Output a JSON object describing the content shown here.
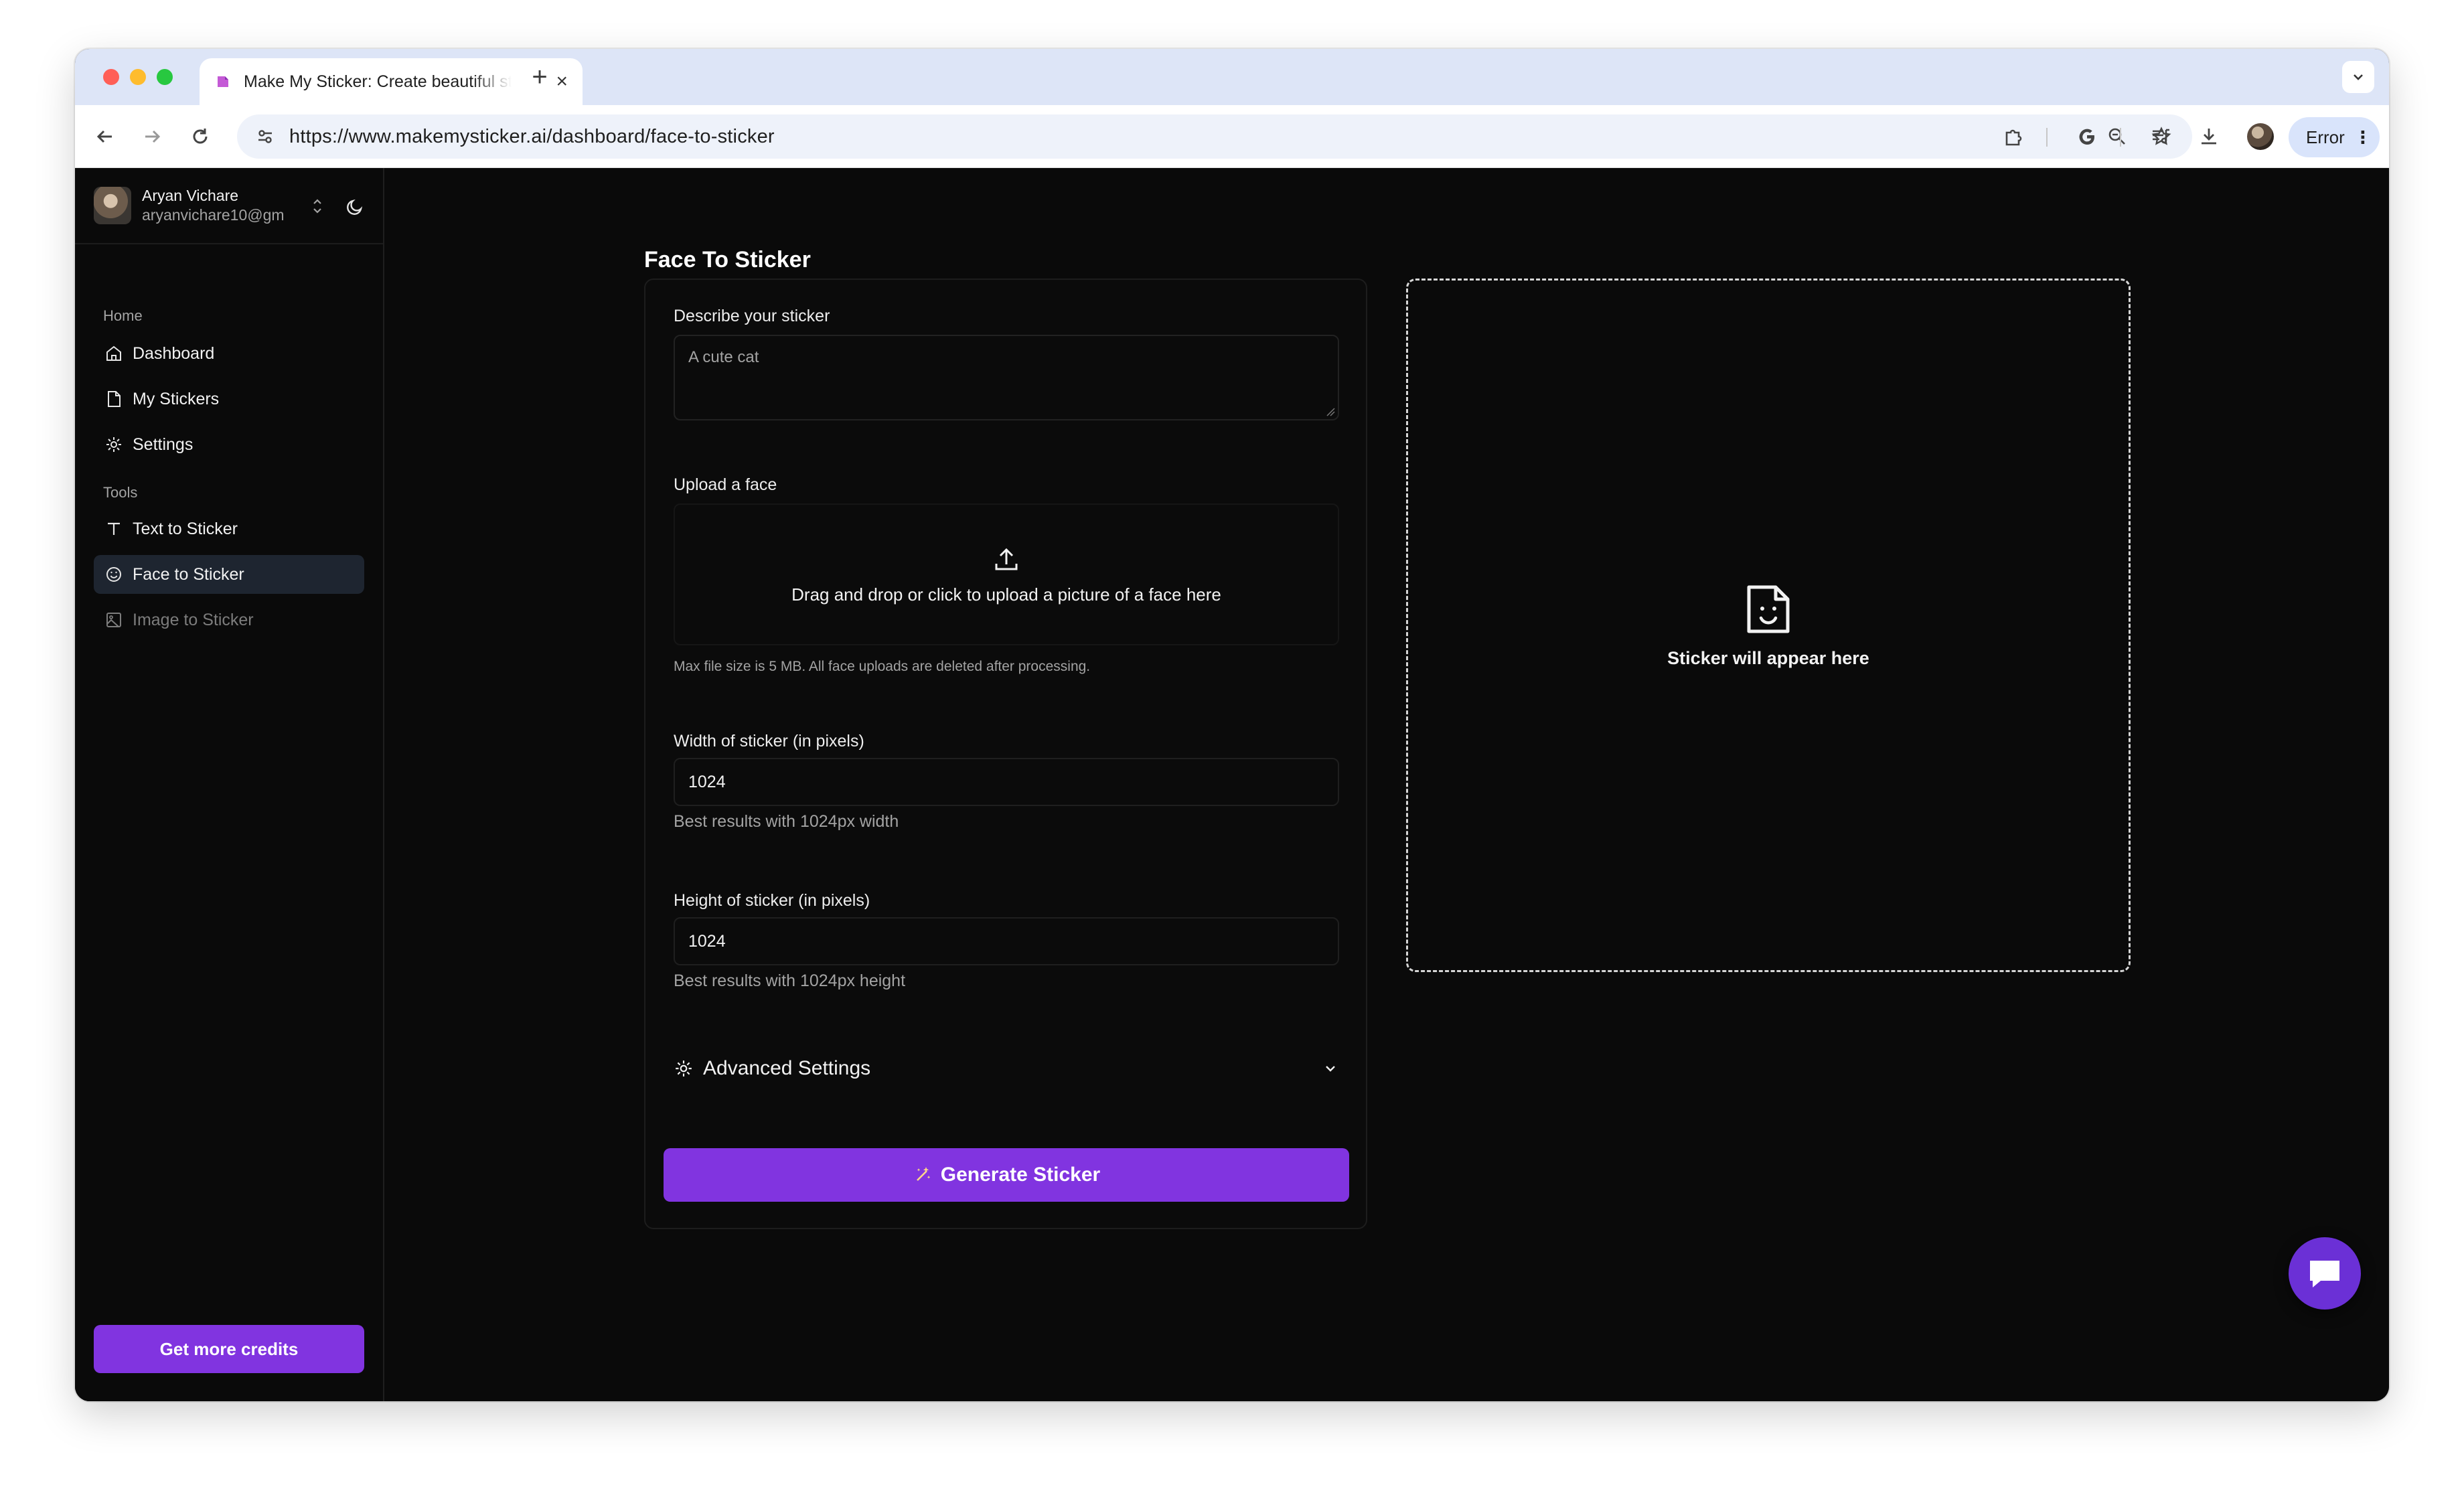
{
  "browser": {
    "tab_title": "Make My Sticker: Create beautiful stickers",
    "new_tab_label": "+",
    "url": "https://www.makemysticker.ai/dashboard/face-to-sticker",
    "profile_button_label": "Error"
  },
  "sidebar": {
    "user": {
      "name": "Aryan Vichare",
      "email": "aryanvichare10@gm"
    },
    "groups": [
      {
        "label": "Home",
        "items": [
          {
            "label": "Dashboard",
            "icon": "home-icon"
          },
          {
            "label": "My Stickers",
            "icon": "file-icon"
          },
          {
            "label": "Settings",
            "icon": "gear-icon"
          }
        ]
      },
      {
        "label": "Tools",
        "items": [
          {
            "label": "Text to Sticker",
            "icon": "text-icon"
          },
          {
            "label": "Face to Sticker",
            "icon": "smile-icon",
            "active": true
          },
          {
            "label": "Image to Sticker",
            "icon": "image-icon",
            "disabled": true
          }
        ]
      }
    ],
    "credits_button": "Get more credits"
  },
  "main": {
    "title": "Face To Sticker",
    "form": {
      "describe_label": "Describe your sticker",
      "describe_placeholder": "A cute cat",
      "upload_label": "Upload a face",
      "upload_prompt": "Drag and drop or click to upload a picture of a face here",
      "upload_hint": "Max file size is 5 MB. All face uploads are deleted after processing.",
      "width_label": "Width of sticker (in pixels)",
      "width_value": "1024",
      "width_hint": "Best results with 1024px width",
      "height_label": "Height of sticker (in pixels)",
      "height_value": "1024",
      "height_hint": "Best results with 1024px height",
      "advanced_label": "Advanced Settings",
      "generate_label": "Generate Sticker"
    },
    "preview_text": "Sticker will appear here"
  },
  "colors": {
    "accent": "#8134e0",
    "background": "#0a0a0a",
    "chat_button": "#6b30d6"
  }
}
